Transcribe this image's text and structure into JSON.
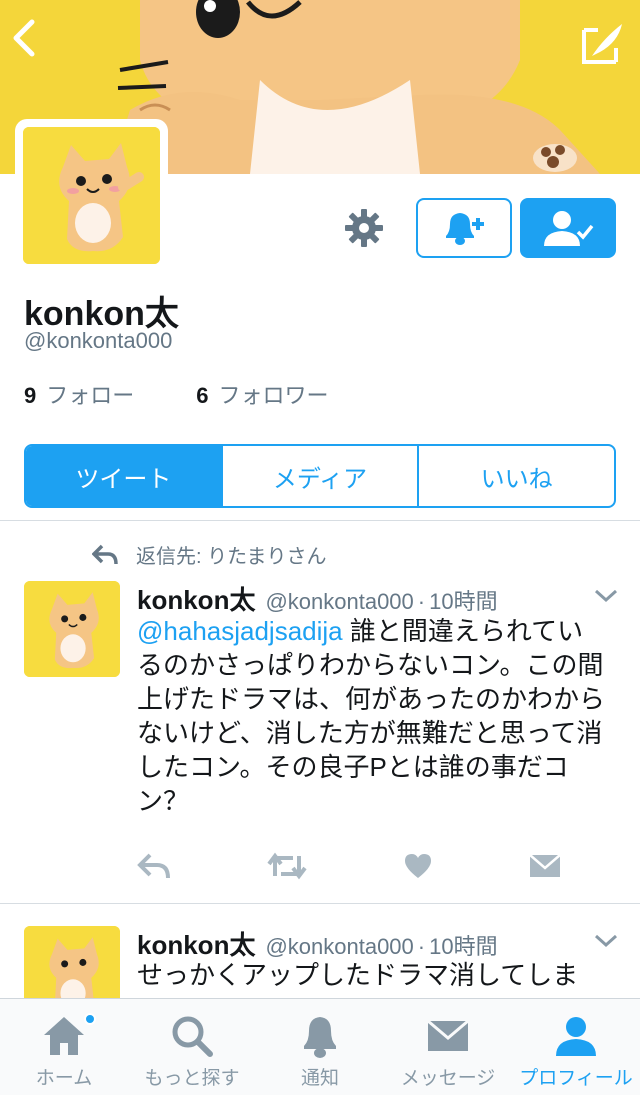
{
  "colors": {
    "accent": "#1da1f2",
    "banner": "#f4d63a",
    "muted": "#657786",
    "text": "#14171a"
  },
  "header": {
    "back_icon": "chevron-left-icon",
    "compose_icon": "compose-feather-icon"
  },
  "profile": {
    "name": "konkon太",
    "handle": "@konkonta000",
    "following_count": "9",
    "following_label": "フォロー",
    "followers_count": "6",
    "followers_label": "フォロワー"
  },
  "actions": {
    "settings_icon": "gear-icon",
    "notify_icon": "bell-plus-icon",
    "follow_icon": "person-check-icon"
  },
  "tabs": [
    {
      "label": "ツイート",
      "active": true
    },
    {
      "label": "メディア",
      "active": false
    },
    {
      "label": "いいね",
      "active": false
    }
  ],
  "tweets": [
    {
      "reply_context": "返信先: りたまりさん",
      "name": "konkon太",
      "handle": "@konkonta000",
      "separator": "·",
      "time": "10時間",
      "mention": "@hahasjadjsadija",
      "text": " 誰と間違えられているのかさっぱりわからないコン。この間上げたドラマは、何があったのかわからないけど、消した方が無難だと思って消したコン。その良子Pとは誰の事だコン？"
    },
    {
      "name": "konkon太",
      "handle": "@konkonta000",
      "separator": "·",
      "time": "10時間",
      "text": "せっかくアップしたドラマ消してしま"
    }
  ],
  "tabbar": [
    {
      "label": "ホーム",
      "icon": "home-icon",
      "active": false
    },
    {
      "label": "もっと探す",
      "icon": "search-icon",
      "active": false
    },
    {
      "label": "通知",
      "icon": "bell-icon",
      "active": false
    },
    {
      "label": "メッセージ",
      "icon": "envelope-icon",
      "active": false
    },
    {
      "label": "プロフィール",
      "icon": "profile-icon",
      "active": true
    }
  ]
}
